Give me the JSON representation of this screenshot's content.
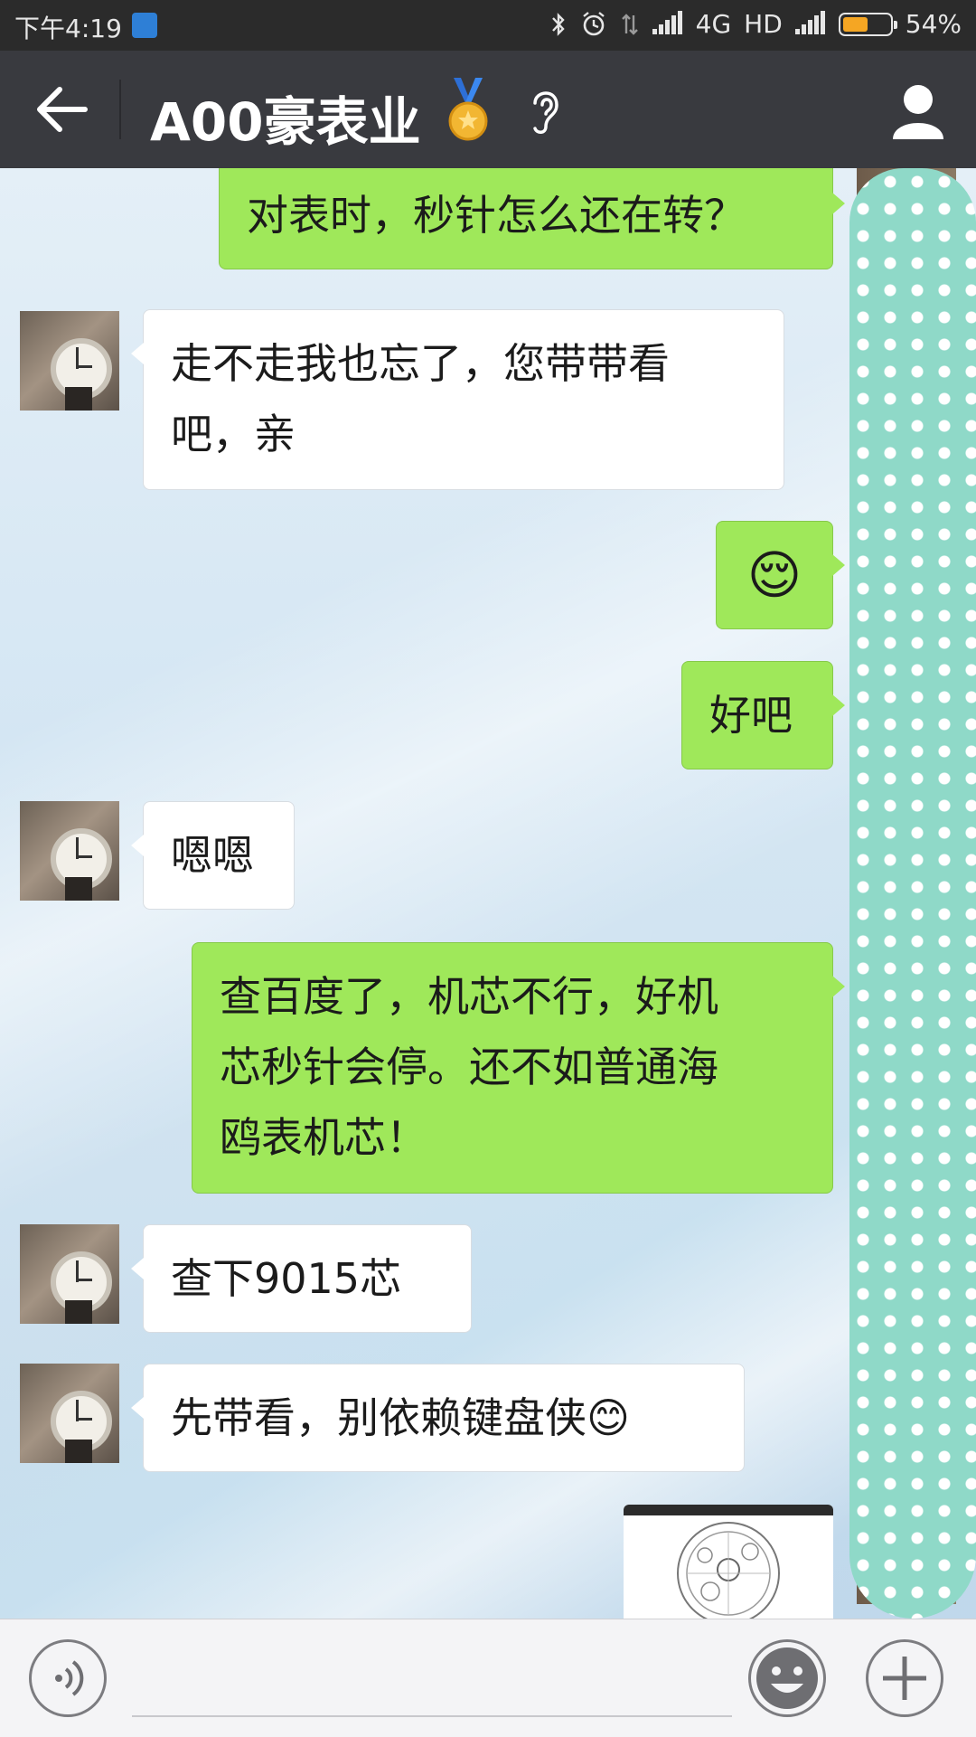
{
  "status_bar": {
    "time": "下午4:19",
    "network": "4G",
    "hd": "HD",
    "battery_percent": "54%",
    "battery_level": 0.54,
    "icons": [
      "bluetooth-icon",
      "alarm-icon",
      "data-arrows-icon",
      "signal-icon",
      "signal-icon",
      "battery-icon"
    ]
  },
  "header": {
    "title": "A00豪表业",
    "icons": [
      "back-arrow-icon",
      "medal-icon",
      "ear-icon",
      "profile-icon"
    ]
  },
  "messages": [
    {
      "side": "out",
      "text": "对表时，秒针怎么还在转？"
    },
    {
      "side": "in",
      "line1": "走不走我也忘了，您带带看",
      "line2": "吧，亲"
    },
    {
      "side": "out",
      "emoji": "😌"
    },
    {
      "side": "out",
      "text": "好吧"
    },
    {
      "side": "in",
      "text": "嗯嗯"
    },
    {
      "side": "out",
      "line1": "查百度了，机芯不行，好机",
      "line2": "芯秒针会停。还不如普通海",
      "line3": "鸥表机芯！"
    },
    {
      "side": "in",
      "text": "查下9015芯"
    },
    {
      "side": "in",
      "text": "先带看，别依赖键盘侠😊"
    },
    {
      "side": "out",
      "image": "watch-movement-screenshot"
    }
  ],
  "input_bar": {
    "icons": [
      "voice-icon",
      "emoji-face-icon",
      "plus-icon"
    ]
  },
  "colors": {
    "status_bg": "#2b2b2b",
    "header_bg": "#393a3f",
    "bubble_out": "#9fe85a",
    "bubble_in": "#ffffff",
    "cover_teal": "#8fd9c8"
  }
}
